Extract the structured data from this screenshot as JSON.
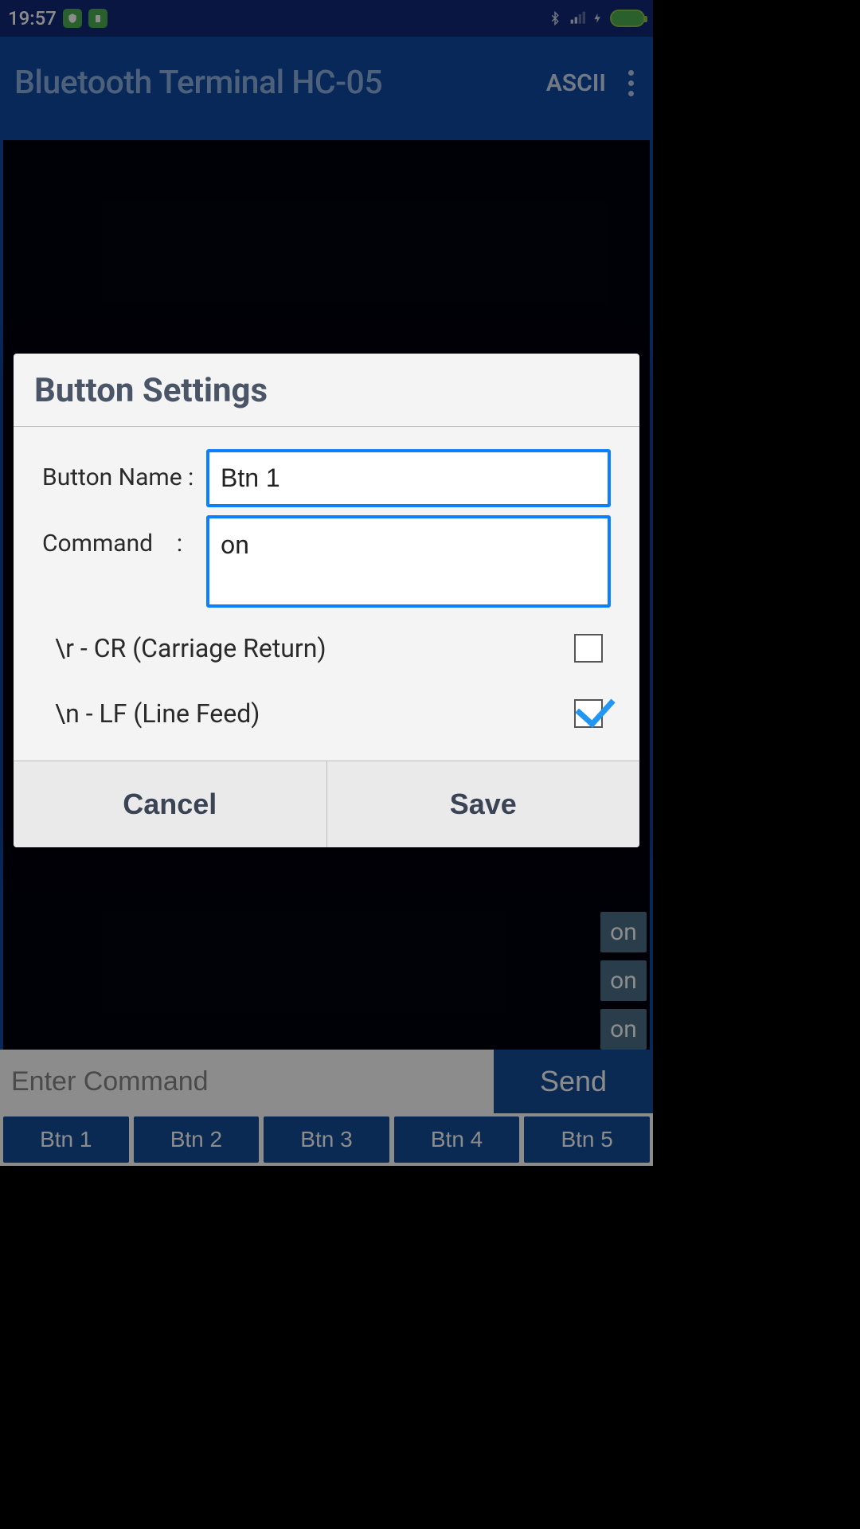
{
  "status": {
    "time": "19:57"
  },
  "appbar": {
    "title": "Bluetooth Terminal HC-05",
    "mode": "ASCII"
  },
  "terminal": {
    "messages": [
      "on",
      "on",
      "on"
    ]
  },
  "cmd": {
    "placeholder": "Enter Command",
    "send": "Send"
  },
  "presets": [
    "Btn 1",
    "Btn 2",
    "Btn 3",
    "Btn 4",
    "Btn 5"
  ],
  "dialog": {
    "title": "Button Settings",
    "name_label": "Button Name :",
    "name_value": "Btn 1",
    "cmd_label": "Command",
    "cmd_colon": ":",
    "cmd_value": "on",
    "cr_label": "\\r - CR (Carriage Return)",
    "lf_label": "\\n - LF (Line Feed)",
    "cancel": "Cancel",
    "save": "Save"
  }
}
